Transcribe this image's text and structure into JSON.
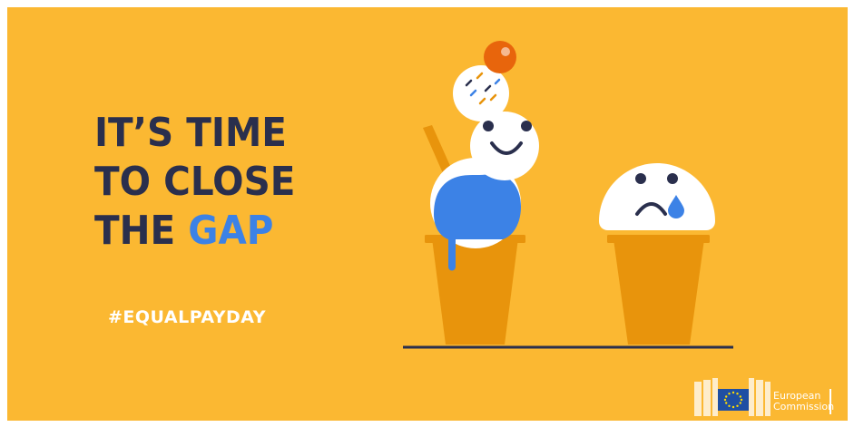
{
  "headline": {
    "line1": "IT’S TIME",
    "line2": "TO CLOSE",
    "line3_prefix": "THE ",
    "line3_highlight": "GAP"
  },
  "hashtag": "#EQUALPAYDAY",
  "logo": {
    "line1": "European",
    "line2": "Commission"
  },
  "colors": {
    "background": "#fbb832",
    "headline": "#2a2f4d",
    "highlight": "#3c82e6",
    "cone": "#e8940c",
    "ice_cream": "#ffffff",
    "ice_cream_blue": "#3c82e6",
    "cherry": "#e8650c"
  },
  "icons": [
    "happy-ice-cream-cone-icon",
    "sad-ice-cream-cone-icon",
    "eu-flag-icon",
    "european-commission-building-icon"
  ]
}
